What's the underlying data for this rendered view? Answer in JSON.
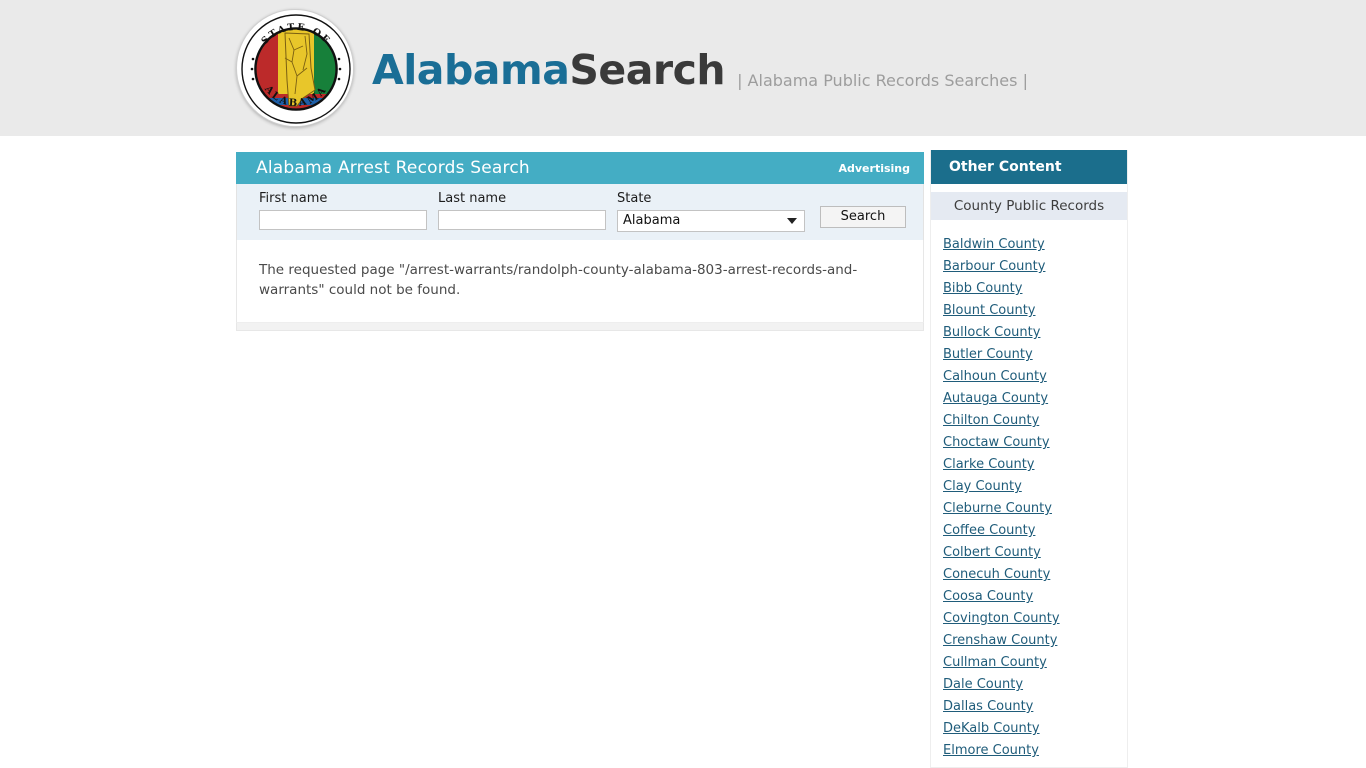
{
  "site": {
    "seal_top_text": "STATE OF",
    "seal_bottom_text": "ALABAMA",
    "brand_primary": "Alabama",
    "brand_secondary": "Search",
    "tagline": "| Alabama Public Records Searches |",
    "colors": {
      "brand_blue": "#1a6e96",
      "brand_dark": "#3a3a3a",
      "panel_teal": "#44adc4",
      "sidebar_teal": "#1b6e8c",
      "link": "#1f5c7a",
      "banner_bg": "#eaeaea",
      "form_bg": "#eaf1f7",
      "subheader_bg": "#e5eaf2"
    }
  },
  "main": {
    "panel_title": "Alabama Arrest Records Search",
    "advertising_label": "Advertising",
    "form": {
      "first_name": {
        "label": "First name",
        "value": "",
        "placeholder": ""
      },
      "last_name": {
        "label": "Last name",
        "value": "",
        "placeholder": ""
      },
      "state": {
        "label": "State",
        "selected": "Alabama",
        "caret_icon": "chevron-down-icon"
      },
      "search_button": "Search"
    },
    "message": "The requested page \"/arrest-warrants/randolph-county-alabama-803-arrest-records-and-warrants\" could not be found."
  },
  "sidebar": {
    "header": "Other Content",
    "subheader": "County Public Records",
    "counties": [
      "Baldwin County",
      "Barbour County",
      "Bibb County",
      "Blount County",
      "Bullock County",
      "Butler County",
      "Calhoun County",
      "Autauga County",
      "Chilton County",
      "Choctaw County",
      "Clarke County",
      "Clay County",
      "Cleburne County",
      "Coffee County",
      "Colbert County",
      "Conecuh County",
      "Coosa County",
      "Covington County",
      "Crenshaw County",
      "Cullman County",
      "Dale County",
      "Dallas County",
      "DeKalb County",
      "Elmore County"
    ]
  }
}
